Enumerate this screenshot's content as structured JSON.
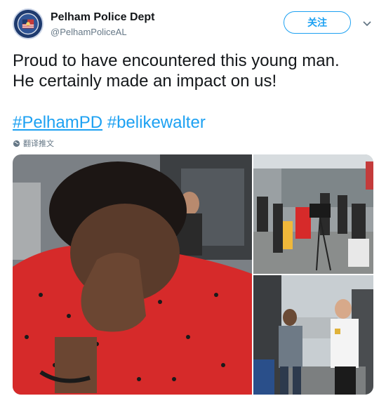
{
  "account": {
    "name": "Pelham Police Dept",
    "handle": "@PelhamPoliceAL",
    "avatar_icon": "police-badge-icon"
  },
  "follow_label": "关注",
  "tweet": {
    "line1": "Proud to have encountered this young man.",
    "line2": "He certainly made an impact on us!",
    "hashtag1": "#PelhamPD",
    "hashtag2": "#belikewalter"
  },
  "translate_label": "翻译推文",
  "colors": {
    "accent": "#1da1f2",
    "shirt": "#d62a2a",
    "secondary_text": "#657786"
  },
  "media": {
    "photos": [
      {
        "description_icon": "photo-man-covering-face"
      },
      {
        "description_icon": "photo-press-crowd"
      },
      {
        "description_icon": "photo-officer-interview"
      }
    ]
  }
}
